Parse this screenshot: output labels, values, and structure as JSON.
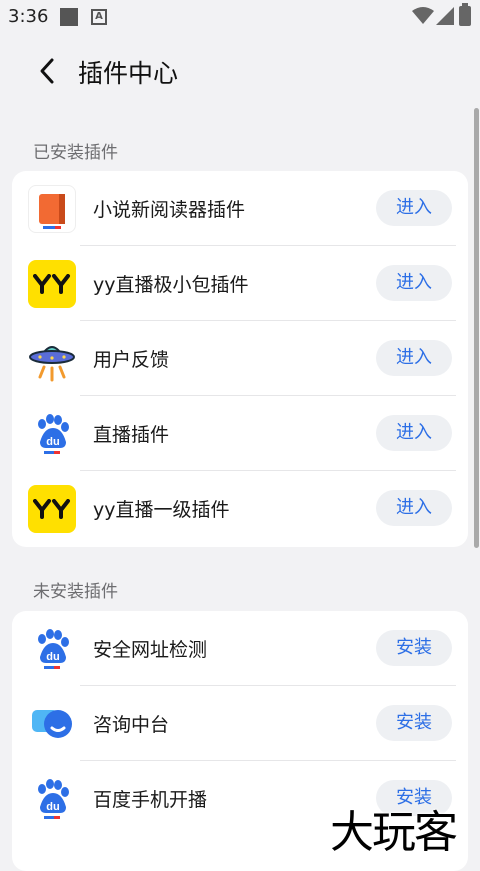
{
  "status_bar": {
    "time": "3:36"
  },
  "header": {
    "title": "插件中心"
  },
  "installed": {
    "section_title": "已安装插件",
    "items": [
      {
        "label": "小说新阅读器插件",
        "action": "进入",
        "icon": "book-icon"
      },
      {
        "label": "yy直播极小包插件",
        "action": "进入",
        "icon": "yy-logo-icon"
      },
      {
        "label": "用户反馈",
        "action": "进入",
        "icon": "ufo-icon"
      },
      {
        "label": "直播插件",
        "action": "进入",
        "icon": "baidu-paw-icon"
      },
      {
        "label": "yy直播一级插件",
        "action": "进入",
        "icon": "yy-logo-icon"
      }
    ]
  },
  "not_installed": {
    "section_title": "未安装插件",
    "items": [
      {
        "label": "安全网址检测",
        "action": "安装",
        "icon": "baidu-paw-icon"
      },
      {
        "label": "咨询中台",
        "action": "安装",
        "icon": "chat-bubble-icon"
      },
      {
        "label": "百度手机开播",
        "action": "安装",
        "icon": "baidu-paw-icon"
      }
    ]
  },
  "watermark": "大玩客",
  "colors": {
    "accent": "#2d6fe6",
    "background": "#f2f2f4",
    "button_bg": "#eef0f3"
  }
}
